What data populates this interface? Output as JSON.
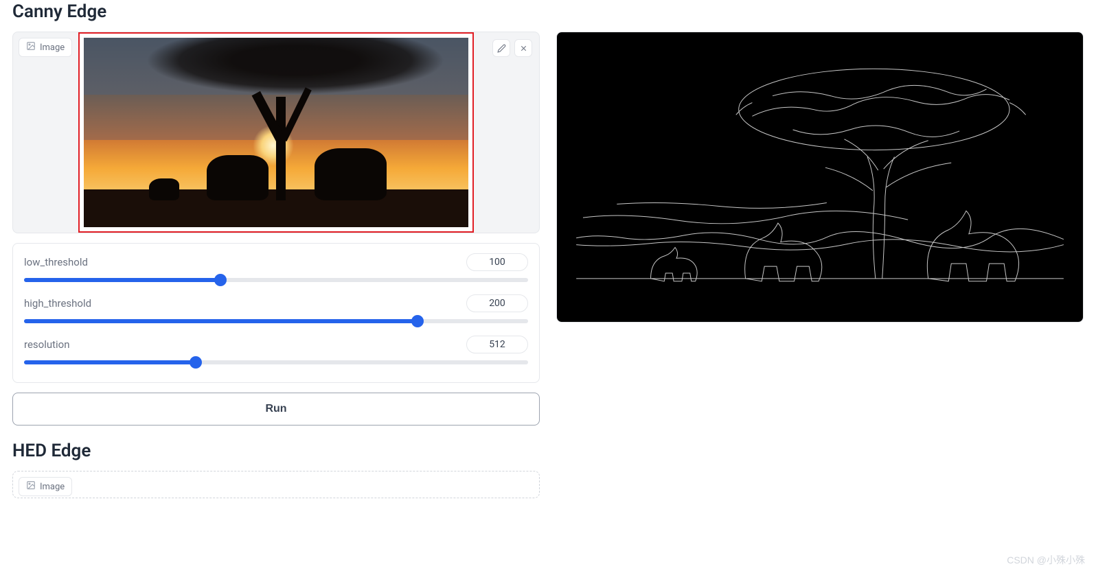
{
  "sections": {
    "canny": {
      "title": "Canny Edge"
    },
    "hed": {
      "title": "HED Edge"
    }
  },
  "image_input": {
    "badge_label": "Image",
    "has_image": true,
    "description": "sunset savanna silhouette with elephants and acacia tree"
  },
  "image_input_hed": {
    "badge_label": "Image"
  },
  "output": {
    "description": "canny edge detection output of elephants and tree"
  },
  "sliders": [
    {
      "key": "low_threshold",
      "label": "low_threshold",
      "value": 100,
      "min": 0,
      "max": 255,
      "fill_pct": 39
    },
    {
      "key": "high_threshold",
      "label": "high_threshold",
      "value": 200,
      "min": 0,
      "max": 255,
      "fill_pct": 78
    },
    {
      "key": "resolution",
      "label": "resolution",
      "value": 512,
      "min": 0,
      "max": 1536,
      "fill_pct": 34
    }
  ],
  "buttons": {
    "run": "Run"
  },
  "watermark": "CSDN @小殊小殊"
}
